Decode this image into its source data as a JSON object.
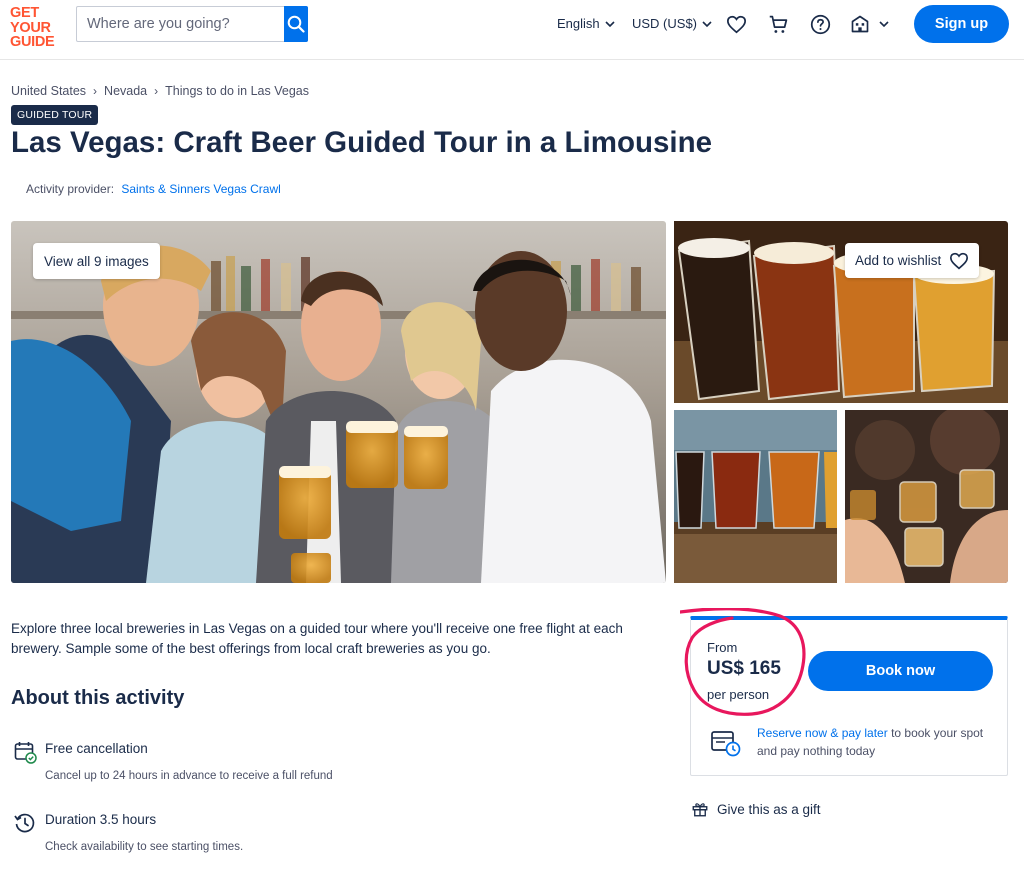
{
  "header": {
    "logo_lines": [
      "GET",
      "YOUR",
      "GUIDE"
    ],
    "search_placeholder": "Where are you going?",
    "language": "English",
    "currency": "USD (US$)",
    "signup_label": "Sign up"
  },
  "breadcrumb": [
    "United States",
    "Nevada",
    "Things to do in Las Vegas"
  ],
  "badge": "GUIDED TOUR",
  "title": "Las Vegas: Craft Beer Guided Tour in a Limousine",
  "provider": {
    "label": "Activity provider:",
    "name": "Saints & Sinners Vegas Crawl"
  },
  "gallery": {
    "view_all_label": "View all 9 images",
    "wishlist_label": "Add to wishlist"
  },
  "description": "Explore three local breweries in Las Vegas on a guided tour where you'll receive one free flight at each brewery. Sample some of the best offerings from local craft breweries as you go.",
  "about": {
    "title": "About this activity",
    "features": [
      {
        "title": "Free cancellation",
        "subtitle": "Cancel up to 24 hours in advance to receive a full refund"
      },
      {
        "title": "Duration 3.5 hours",
        "subtitle": "Check availability to see starting times."
      }
    ]
  },
  "booking": {
    "from_label": "From",
    "price": "US$ 165",
    "per_label": "per person",
    "book_label": "Book now",
    "reserve_link": "Reserve now & pay later",
    "reserve_text": " to book your spot and pay nothing today"
  },
  "gift_label": "Give this as a gift",
  "colors": {
    "brand_orange": "#ff5533",
    "primary_blue": "#0071eb",
    "navy": "#1a2b49",
    "annotation_pink": "#e8175d"
  }
}
